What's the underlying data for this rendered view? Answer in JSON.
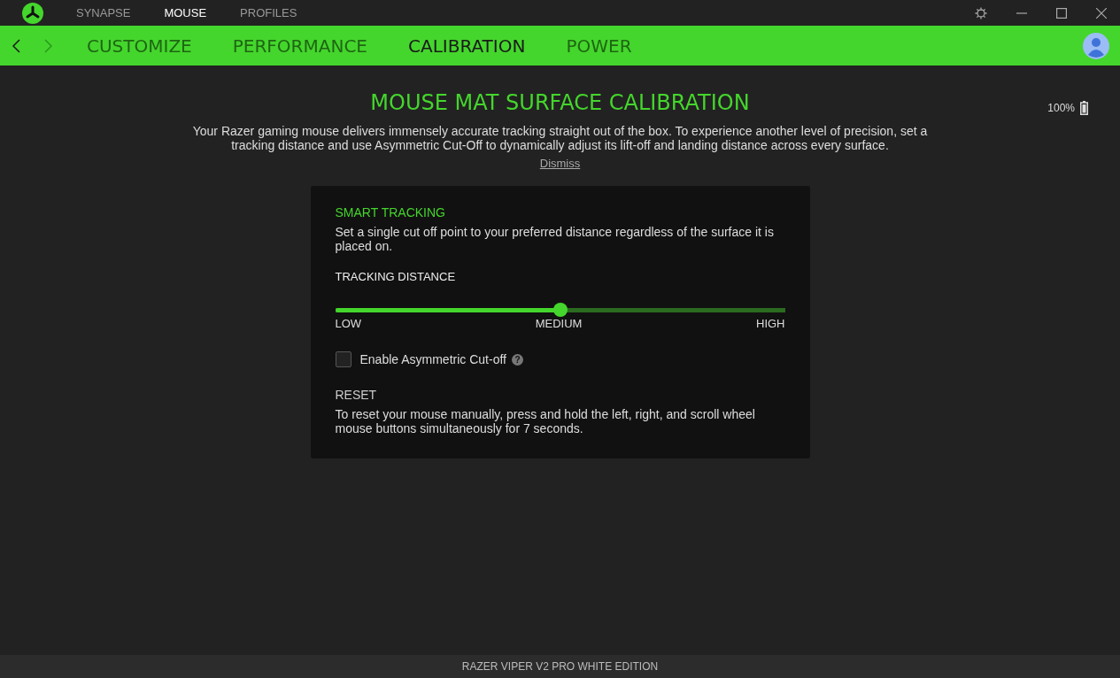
{
  "top_nav": [
    {
      "label": "SYNAPSE",
      "selected": false
    },
    {
      "label": "MOUSE",
      "selected": true
    },
    {
      "label": "PROFILES",
      "selected": false
    }
  ],
  "history": {
    "back_disabled": false,
    "forward_disabled": true
  },
  "tabs": [
    {
      "label": "CUSTOMIZE",
      "selected": false
    },
    {
      "label": "PERFORMANCE",
      "selected": false
    },
    {
      "label": "CALIBRATION",
      "selected": true
    },
    {
      "label": "POWER",
      "selected": false
    }
  ],
  "battery": {
    "reading": "100%"
  },
  "intro": {
    "title": "MOUSE MAT SURFACE CALIBRATION",
    "text": "Your Razer gaming mouse delivers immensely accurate tracking straight out of the box. To experience another level of precision, set a tracking distance and use Asymmetric Cut-Off to dynamically adjust its lift-off and landing distance across every surface.",
    "dismiss": "Dismiss"
  },
  "smart_tracking": {
    "title": "SMART TRACKING",
    "description": "Set a single cut off point to your preferred distance regardless of the surface it is placed on.",
    "distance_label": "TRACKING DISTANCE",
    "level": 0.5,
    "scale": [
      "LOW",
      "MEDIUM",
      "HIGH"
    ],
    "asymmetric": {
      "label": "Enable Asymmetric Cut-off",
      "checked": false,
      "help_glyph": "?"
    }
  },
  "reset": {
    "title": "RESET",
    "text": "To reset your mouse manually, press and hold the left, right, and scroll wheel mouse buttons simultaneously for 7 seconds."
  },
  "status_bar": {
    "device": "RAZER VIPER V2 PRO WHITE EDITION"
  }
}
